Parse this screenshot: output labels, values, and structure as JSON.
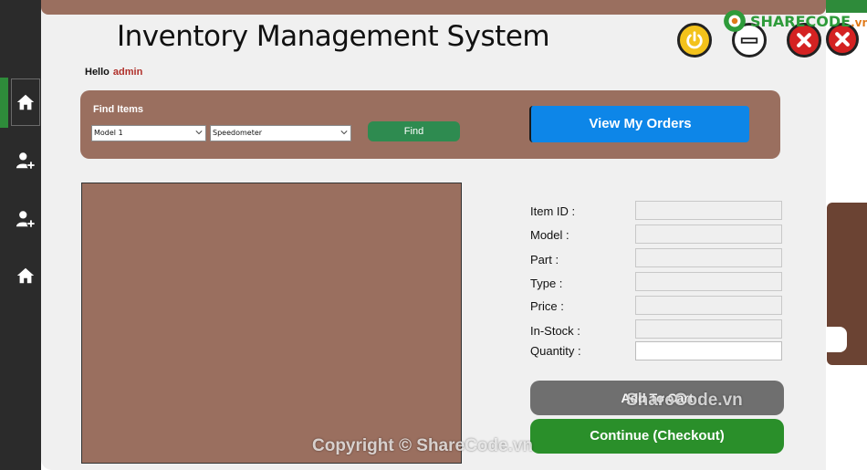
{
  "app": {
    "title": "Inventory Management System",
    "greeting": "Hello",
    "username": "admin"
  },
  "sidebar": {
    "items": [
      {
        "icon": "home-icon",
        "active": true
      },
      {
        "icon": "add-user-icon",
        "active": false
      },
      {
        "icon": "add-user-icon",
        "active": false
      },
      {
        "icon": "home-icon",
        "active": false
      }
    ]
  },
  "window_controls": [
    "power-icon",
    "minimize-icon",
    "close-icon",
    "close-icon"
  ],
  "find": {
    "label": "Find Items",
    "model_value": "Model 1",
    "part_value": "Speedometer",
    "find_label": "Find",
    "orders_label": "View My Orders"
  },
  "form": {
    "fields": [
      {
        "label": "Item ID :",
        "value": ""
      },
      {
        "label": "Model :",
        "value": ""
      },
      {
        "label": "Part :",
        "value": ""
      },
      {
        "label": "Type :",
        "value": ""
      },
      {
        "label": "Price :",
        "value": ""
      },
      {
        "label": "In-Stock :",
        "value": ""
      },
      {
        "label": "Quantity :",
        "value": ""
      }
    ],
    "add_to_cart_label": "Add To Cart",
    "checkout_label": "Continue (Checkout)"
  },
  "watermark": {
    "logo_text": "SHARECODE",
    "logo_suffix": ".vn",
    "center_text": "ShareCode.vn",
    "bottom_text": "Copyright © ShareCode.vn"
  },
  "colors": {
    "brown_panel": "#9a6f5f",
    "sidebar": "#2b2b2b",
    "accent_green": "#2e8b3a",
    "orders_blue": "#0d86e8",
    "checkout_green": "#2a8f2a",
    "cart_gray": "#6f6f6f"
  }
}
